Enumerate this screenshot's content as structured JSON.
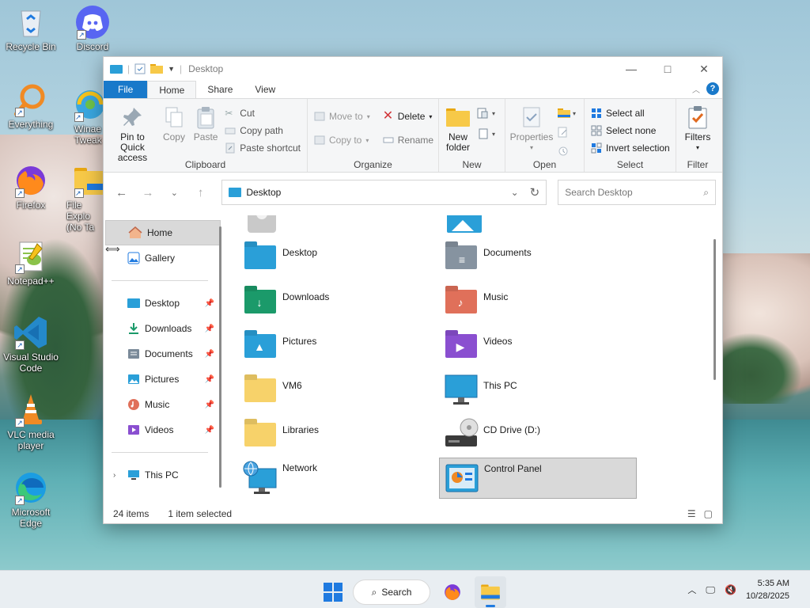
{
  "desktop": {
    "icons": [
      {
        "label": "Recycle Bin"
      },
      {
        "label": "Discord"
      },
      {
        "label": "Everything"
      },
      {
        "label": "Winaero Tweaker",
        "label_visible": "Winae\nTweak"
      },
      {
        "label": "Firefox"
      },
      {
        "label": "File Explorer (No Tab)",
        "label_visible": "File Explo\n(No Ta"
      },
      {
        "label": "Notepad++"
      },
      {
        "label": "Visual Studio Code"
      },
      {
        "label": "VLC media player"
      },
      {
        "label": "Microsoft Edge"
      }
    ]
  },
  "window": {
    "title": "Desktop",
    "ribbon_tabs": [
      "File",
      "Home",
      "Share",
      "View"
    ],
    "clipboard": {
      "pin_label": "Pin to Quick access",
      "copy_label": "Copy",
      "paste_label": "Paste",
      "cut_label": "Cut",
      "copy_path_label": "Copy path",
      "paste_shortcut_label": "Paste shortcut",
      "group_label": "Clipboard"
    },
    "organize": {
      "move_to_label": "Move to",
      "copy_to_label": "Copy to",
      "delete_label": "Delete",
      "rename_label": "Rename",
      "group_label": "Organize"
    },
    "new": {
      "new_folder_label": "New folder",
      "group_label": "New"
    },
    "open": {
      "properties_label": "Properties",
      "group_label": "Open"
    },
    "select": {
      "select_all_label": "Select all",
      "select_none_label": "Select none",
      "invert_label": "Invert selection",
      "group_label": "Select"
    },
    "filter": {
      "filters_label": "Filters",
      "group_label": "Filter"
    },
    "address": {
      "path": "Desktop"
    },
    "search": {
      "placeholder": "Search Desktop"
    },
    "nav": {
      "quick": [
        {
          "label": "Home"
        },
        {
          "label": "Gallery"
        }
      ],
      "pinned": [
        {
          "label": "Desktop"
        },
        {
          "label": "Downloads"
        },
        {
          "label": "Documents"
        },
        {
          "label": "Pictures"
        },
        {
          "label": "Music"
        },
        {
          "label": "Videos"
        }
      ],
      "this_pc": "This PC"
    },
    "items": [
      {
        "label": "Desktop"
      },
      {
        "label": "Documents"
      },
      {
        "label": "Downloads"
      },
      {
        "label": "Music"
      },
      {
        "label": "Pictures"
      },
      {
        "label": "Videos"
      },
      {
        "label": "VM6"
      },
      {
        "label": "This PC"
      },
      {
        "label": "Libraries"
      },
      {
        "label": "CD Drive (D:)"
      },
      {
        "label": "Network"
      },
      {
        "label": "Control Panel"
      }
    ],
    "status": {
      "count": "24 items",
      "selection": "1 item selected"
    }
  },
  "taskbar": {
    "search_label": "Search",
    "time": "5:35 AM",
    "date": "10/28/2025"
  },
  "colors": {
    "accent": "#1979ca",
    "selection": "#d9d9d9",
    "folder_yellow": "#f7c948"
  }
}
